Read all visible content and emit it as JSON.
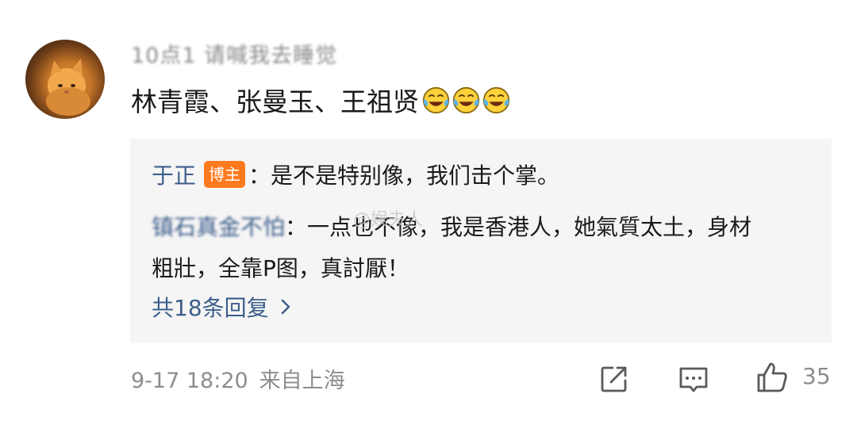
{
  "comment": {
    "username": "10点1 请喊我去睡觉",
    "text": "林青霞、张曼玉、王祖贤",
    "emojis": [
      "laugh-cry-emoji",
      "laugh-cry-emoji",
      "laugh-cry-emoji"
    ]
  },
  "replies": {
    "first": {
      "author": "于正",
      "badge": "博主",
      "separator": "：",
      "text": "是不是特别像，我们击个掌。"
    },
    "second": {
      "author": "镇石真金不怕",
      "separator": "：",
      "text": "一点也不像，我是香港人，她氣質太土，身材粗壯，全靠P图，真討厭！"
    },
    "more_label": "共18条回复"
  },
  "watermark": "@娱夫人",
  "footer": {
    "time": "9-17 18:20",
    "location": "来自上海",
    "like_count": "35"
  },
  "colors": {
    "link": "#3d5e8c",
    "badge": "#ff7a1e",
    "reply_bg": "#f5f5f5",
    "meta": "#8d8d8d"
  },
  "icons": {
    "share": "share-icon",
    "comment": "comment-icon",
    "like": "thumbs-up-icon",
    "more": "chevron-right-icon"
  }
}
